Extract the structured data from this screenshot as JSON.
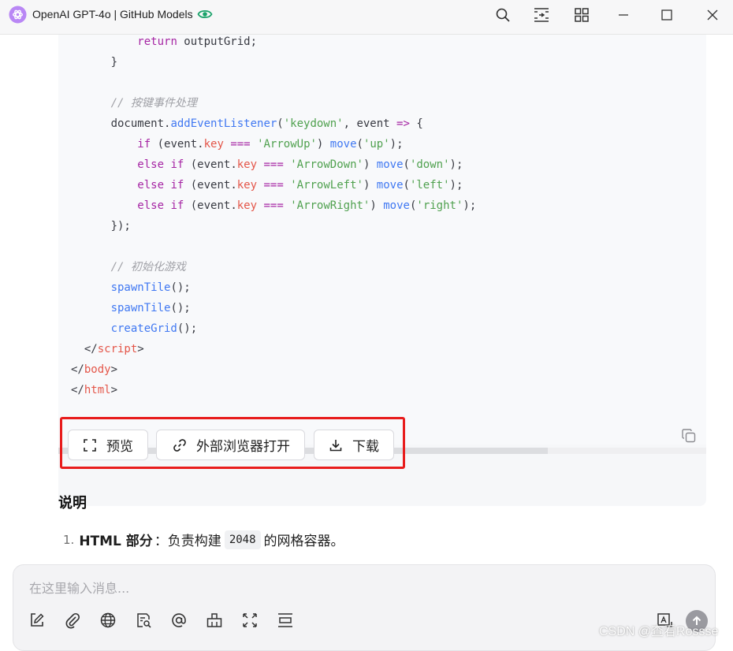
{
  "window": {
    "title": "OpenAI GPT-4o | GitHub Models",
    "icons": [
      "app-logo-icon",
      "eye-icon",
      "search-icon",
      "layout-icon",
      "grid-icon",
      "minimize-icon",
      "maximize-icon",
      "close-icon"
    ]
  },
  "code": {
    "lines": [
      [
        {
          "t": "        "
        },
        {
          "t": "return",
          "c": "kw"
        },
        {
          "t": " outputGrid;"
        }
      ],
      [
        {
          "t": "    }"
        }
      ],
      [
        {
          "t": ""
        }
      ],
      [
        {
          "t": "    "
        },
        {
          "t": "// 按键事件处理",
          "c": "cmt"
        }
      ],
      [
        {
          "t": "    document."
        },
        {
          "t": "addEventListener",
          "c": "fn"
        },
        {
          "t": "("
        },
        {
          "t": "'keydown'",
          "c": "str"
        },
        {
          "t": ", event "
        },
        {
          "t": "=>",
          "c": "op"
        },
        {
          "t": " {"
        }
      ],
      [
        {
          "t": "        "
        },
        {
          "t": "if",
          "c": "kw"
        },
        {
          "t": " (event."
        },
        {
          "t": "key",
          "c": "prop"
        },
        {
          "t": " "
        },
        {
          "t": "===",
          "c": "op"
        },
        {
          "t": " "
        },
        {
          "t": "'ArrowUp'",
          "c": "str"
        },
        {
          "t": ") "
        },
        {
          "t": "move",
          "c": "fn"
        },
        {
          "t": "("
        },
        {
          "t": "'up'",
          "c": "str"
        },
        {
          "t": ");"
        }
      ],
      [
        {
          "t": "        "
        },
        {
          "t": "else if",
          "c": "kw"
        },
        {
          "t": " (event."
        },
        {
          "t": "key",
          "c": "prop"
        },
        {
          "t": " "
        },
        {
          "t": "===",
          "c": "op"
        },
        {
          "t": " "
        },
        {
          "t": "'ArrowDown'",
          "c": "str"
        },
        {
          "t": ") "
        },
        {
          "t": "move",
          "c": "fn"
        },
        {
          "t": "("
        },
        {
          "t": "'down'",
          "c": "str"
        },
        {
          "t": ");"
        }
      ],
      [
        {
          "t": "        "
        },
        {
          "t": "else if",
          "c": "kw"
        },
        {
          "t": " (event."
        },
        {
          "t": "key",
          "c": "prop"
        },
        {
          "t": " "
        },
        {
          "t": "===",
          "c": "op"
        },
        {
          "t": " "
        },
        {
          "t": "'ArrowLeft'",
          "c": "str"
        },
        {
          "t": ") "
        },
        {
          "t": "move",
          "c": "fn"
        },
        {
          "t": "("
        },
        {
          "t": "'left'",
          "c": "str"
        },
        {
          "t": ");"
        }
      ],
      [
        {
          "t": "        "
        },
        {
          "t": "else if",
          "c": "kw"
        },
        {
          "t": " (event."
        },
        {
          "t": "key",
          "c": "prop"
        },
        {
          "t": " "
        },
        {
          "t": "===",
          "c": "op"
        },
        {
          "t": " "
        },
        {
          "t": "'ArrowRight'",
          "c": "str"
        },
        {
          "t": ") "
        },
        {
          "t": "move",
          "c": "fn"
        },
        {
          "t": "("
        },
        {
          "t": "'right'",
          "c": "str"
        },
        {
          "t": ");"
        }
      ],
      [
        {
          "t": "    });"
        }
      ],
      [
        {
          "t": ""
        }
      ],
      [
        {
          "t": "    "
        },
        {
          "t": "// 初始化游戏",
          "c": "cmt"
        }
      ],
      [
        {
          "t": "    "
        },
        {
          "t": "spawnTile",
          "c": "fn"
        },
        {
          "t": "();"
        }
      ],
      [
        {
          "t": "    "
        },
        {
          "t": "spawnTile",
          "c": "fn"
        },
        {
          "t": "();"
        }
      ],
      [
        {
          "t": "    "
        },
        {
          "t": "createGrid",
          "c": "fn"
        },
        {
          "t": "();"
        }
      ],
      [
        {
          "t": "</"
        },
        {
          "t": "script",
          "c": "tag"
        },
        {
          "t": ">"
        }
      ],
      [
        {
          "t": "</"
        },
        {
          "t": "body",
          "c": "tag"
        },
        {
          "t": ">"
        }
      ],
      [
        {
          "t": "</"
        },
        {
          "t": "html",
          "c": "tag"
        },
        {
          "t": ">"
        }
      ]
    ],
    "line_indent_prefix": [
      "  ",
      "  ",
      "",
      "  ",
      "  ",
      "  ",
      "  ",
      "  ",
      "  ",
      "  ",
      "",
      "  ",
      "  ",
      "  ",
      "  ",
      "  ",
      "",
      ""
    ],
    "copy_icon": "copy-icon"
  },
  "actions": {
    "preview_label": "预览",
    "open_external_label": "外部浏览器打开",
    "download_label": "下载",
    "icons": [
      "expand-icon",
      "link-icon",
      "download-icon"
    ]
  },
  "explanation": {
    "heading": "说明",
    "item1": {
      "number": "1.",
      "bold": "HTML 部分",
      "text_before": "：负责构建",
      "code": "2048",
      "text_after": "的网格容器。"
    }
  },
  "composer": {
    "placeholder": "在这里输入消息...",
    "tools": [
      "edit-icon",
      "attach-icon",
      "globe-icon",
      "doc-search-icon",
      "mention-icon",
      "toolbox-icon",
      "fullscreen-icon",
      "layout-lines-icon",
      "image-text-icon",
      "send-icon"
    ]
  },
  "watermark": "CSDN @查看Rossse"
}
